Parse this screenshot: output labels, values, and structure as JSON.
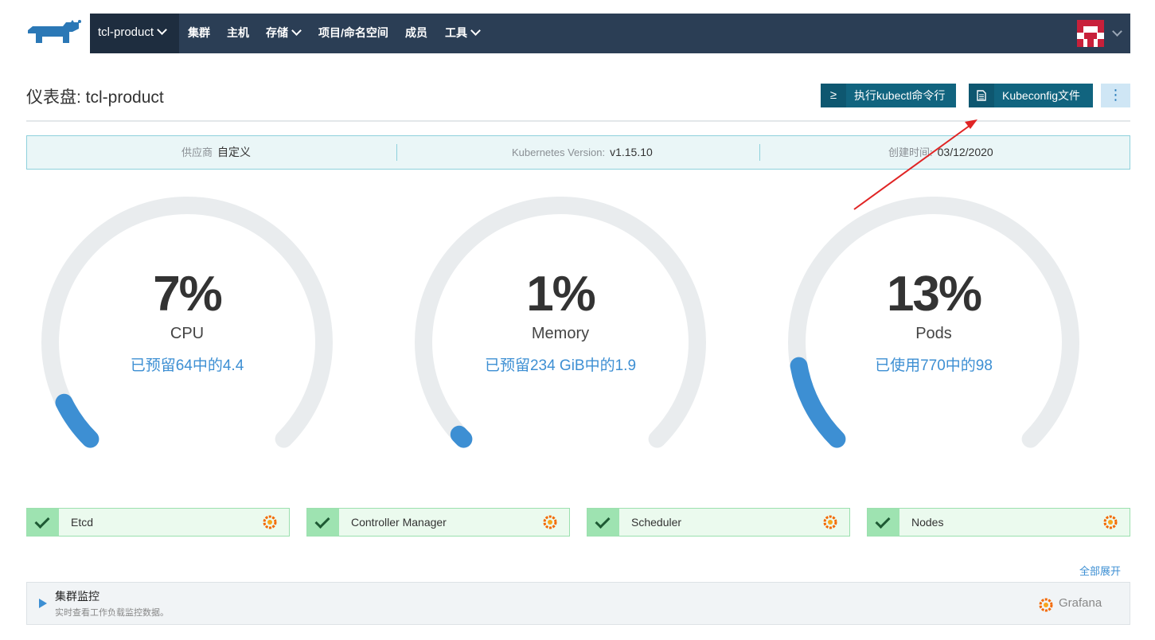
{
  "nav": {
    "cluster": "tcl-product",
    "items": [
      "集群",
      "主机",
      "存储",
      "项目/命名空间",
      "成员",
      "工具"
    ]
  },
  "header": {
    "title": "仪表盘: tcl-product",
    "kubectl_button": "执行kubectl命令行",
    "kubeconfig_button": "Kubeconfig文件",
    "kubectl_icon": "≥",
    "more_icon": "⋮"
  },
  "info": {
    "provider_label": "供应商",
    "provider_value": "自定义",
    "k8s_label": "Kubernetes Version:",
    "k8s_value": "v1.15.10",
    "created_label": "创建时间:",
    "created_value": "03/12/2020"
  },
  "gauges": [
    {
      "percent": "7%",
      "value": 0.07,
      "label": "CPU",
      "sub": "已预留64中的4.4"
    },
    {
      "percent": "1%",
      "value": 0.01,
      "label": "Memory",
      "sub": "已预留234 GiB中的1.9"
    },
    {
      "percent": "13%",
      "value": 0.13,
      "label": "Pods",
      "sub": "已使用770中的98"
    }
  ],
  "status": [
    "Etcd",
    "Controller Manager",
    "Scheduler",
    "Nodes"
  ],
  "expand_all": "全部展开",
  "monitor": {
    "title": "集群监控",
    "desc": "实时查看工作负载监控数据。",
    "grafana": "Grafana"
  },
  "colors": {
    "nav_bg": "#2b3e55",
    "accent": "#3d8fd3",
    "button": "#11647f",
    "status_green": "#9ee3b1",
    "gauge_track": "#e9ecee",
    "annotation": "#e02424"
  }
}
